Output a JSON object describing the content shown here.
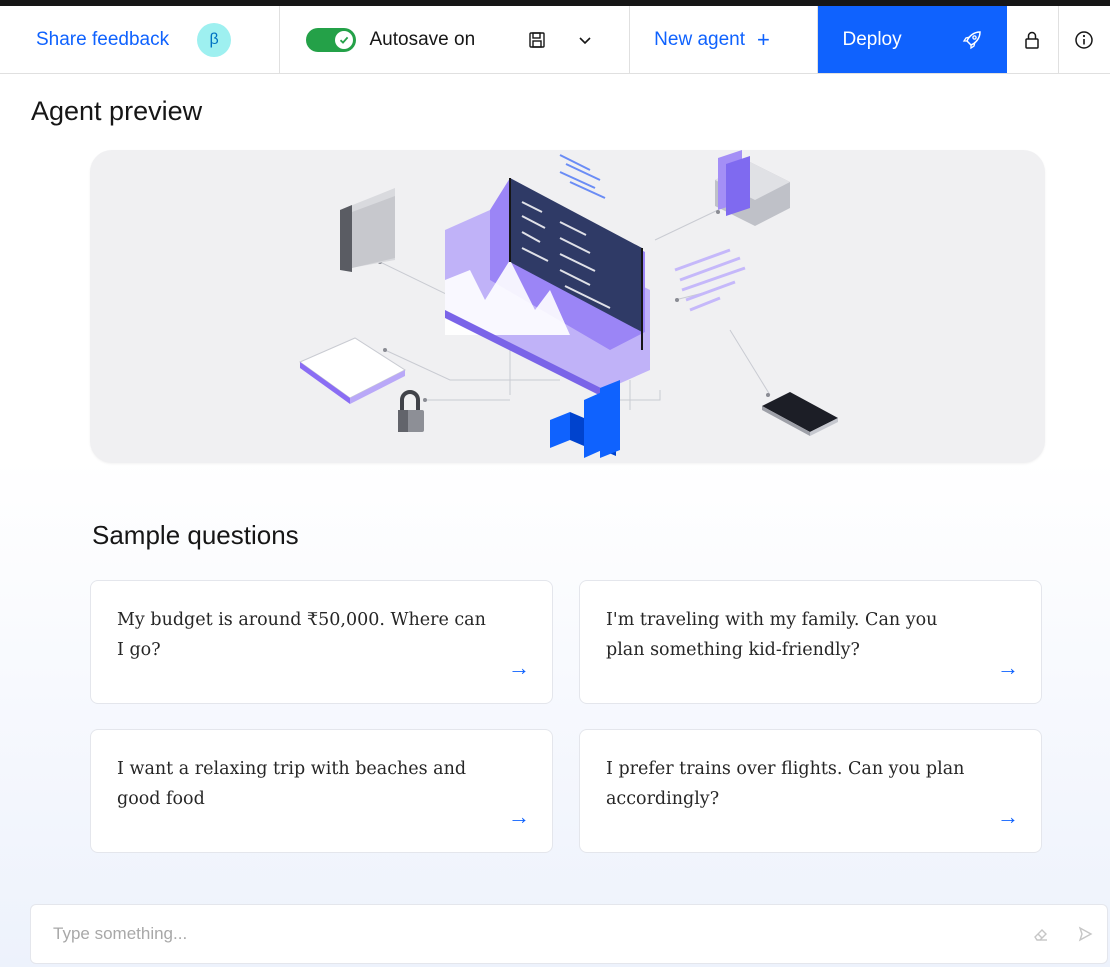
{
  "toolbar": {
    "share_feedback_label": "Share feedback",
    "beta_badge": "β",
    "autosave_label": "Autosave on",
    "new_agent_label": "New agent",
    "new_agent_plus": "+",
    "deploy_label": "Deploy"
  },
  "page": {
    "title": "Agent preview"
  },
  "sample": {
    "title": "Sample questions",
    "questions": [
      {
        "text": "My budget is around ₹50,000. Where can I go?",
        "arrow": "→"
      },
      {
        "text": "I'm traveling with my family. Can you plan something kid-friendly?",
        "arrow": "→"
      },
      {
        "text": "I want a relaxing trip with beaches and good food",
        "arrow": "→"
      },
      {
        "text": "I prefer trains over flights. Can you plan accordingly?",
        "arrow": "→"
      }
    ]
  },
  "chat": {
    "placeholder": "Type something..."
  },
  "colors": {
    "accent": "#0f62fe",
    "toggle_on": "#24a148",
    "beta_badge_bg": "#9ef0f0",
    "illustration_purple": "#8a6df4"
  },
  "icons": {
    "save": "save-icon",
    "caret": "chevron-down-icon",
    "deploy": "rocket-icon",
    "lock": "lock-icon",
    "info": "info-icon",
    "clear": "eraser-icon",
    "send": "send-icon"
  }
}
